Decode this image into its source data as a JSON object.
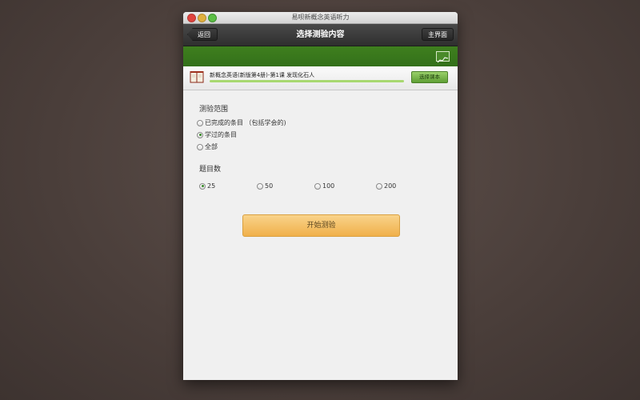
{
  "window": {
    "title": "易呗新概念英语听力"
  },
  "navbar": {
    "back_label": "返回",
    "title": "选择测验内容",
    "home_label": "主界面"
  },
  "book": {
    "title": "新概念英语(新版第4册)-第1课  发现化石人",
    "progress": 1.0,
    "select_label": "选择课本"
  },
  "range": {
    "label": "测验范围",
    "options": [
      {
        "label": "已完成的条目 （包括学会的)",
        "selected": false
      },
      {
        "label": "学过的条目",
        "selected": true
      },
      {
        "label": "全部",
        "selected": false
      }
    ]
  },
  "count": {
    "label": "题目数",
    "options": [
      {
        "label": "25",
        "selected": true
      },
      {
        "label": "50",
        "selected": false
      },
      {
        "label": "100",
        "selected": false
      },
      {
        "label": "200",
        "selected": false
      }
    ]
  },
  "start_label": "开始测验",
  "colors": {
    "accent_green": "#3a7a1c",
    "button_orange": "#f0b04a"
  }
}
